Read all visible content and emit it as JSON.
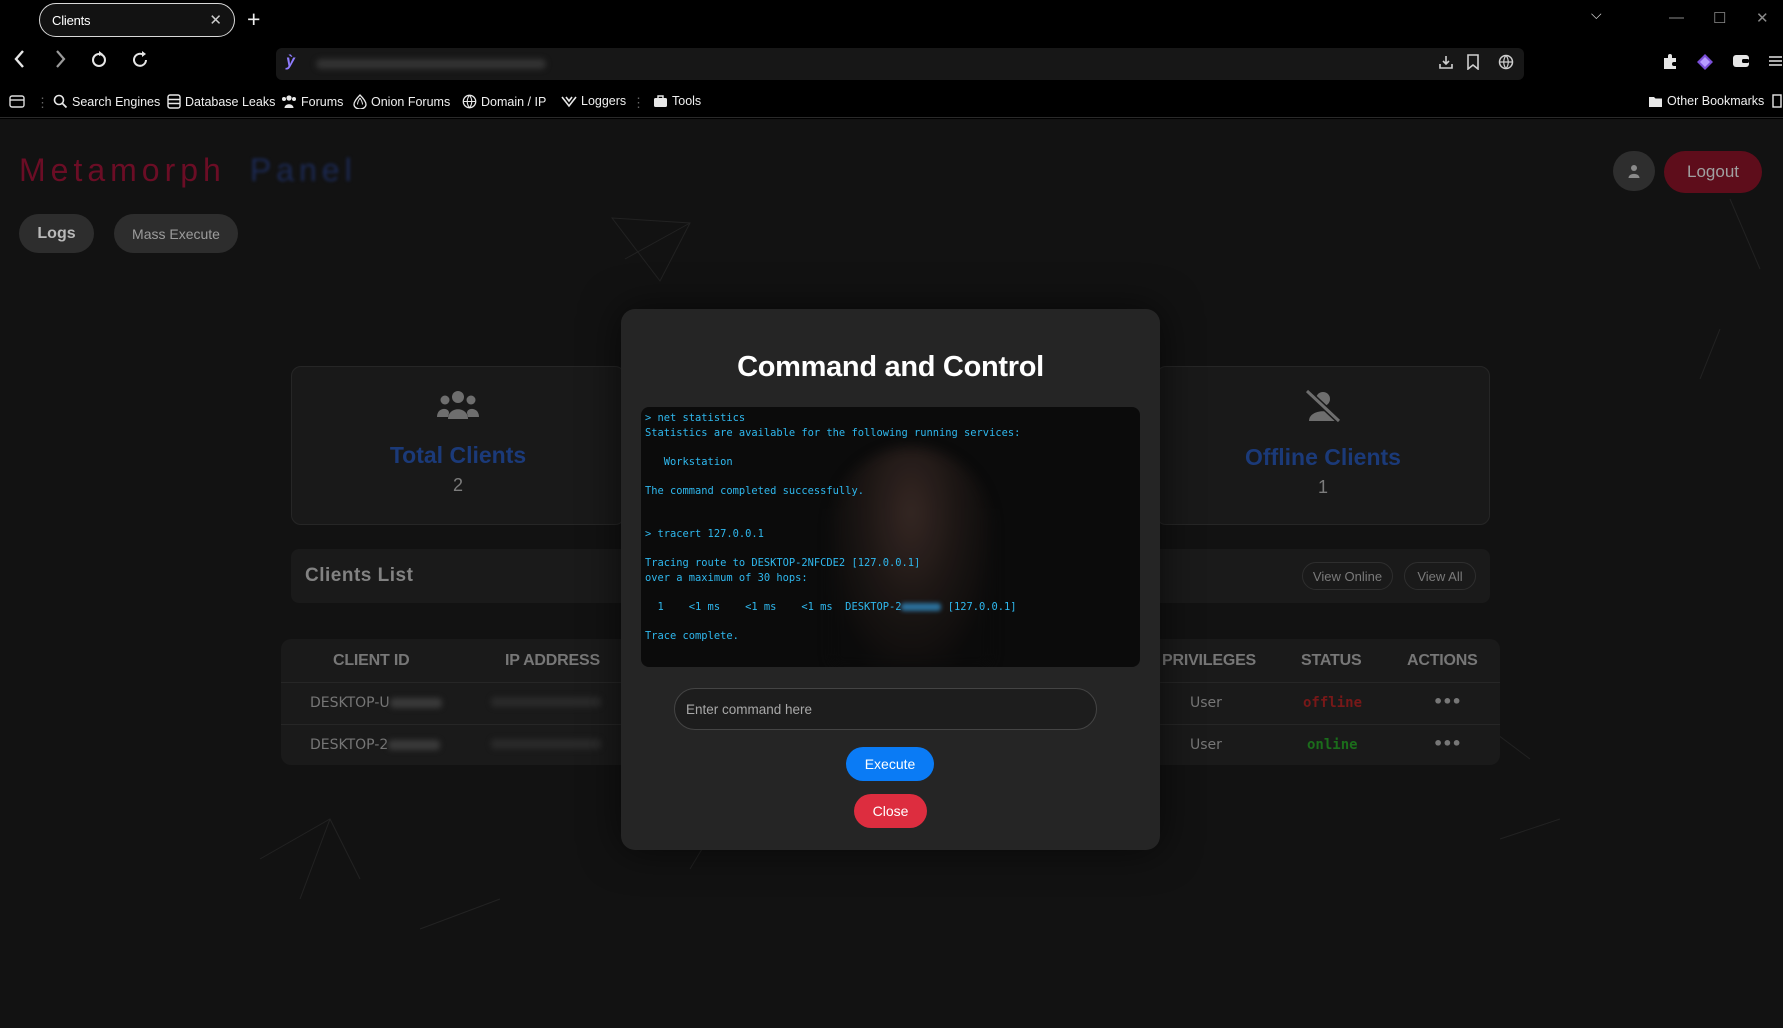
{
  "browser": {
    "tab_title": "Clients",
    "tab_close": "✕",
    "new_tab": "+",
    "tab_menu": "⌵",
    "window_controls": {
      "minimize": "—",
      "maximize": "☐",
      "close": "✕"
    },
    "url_logo": "ỳ",
    "bookmarks": [
      {
        "label": "Search Engines",
        "icon": "search-icon"
      },
      {
        "label": "Database Leaks",
        "icon": "database-icon"
      },
      {
        "label": "Forums",
        "icon": "people-icon"
      },
      {
        "label": "Onion Forums",
        "icon": "onion-icon"
      },
      {
        "label": "Domain / IP",
        "icon": "globe-icon"
      },
      {
        "label": "Loggers",
        "icon": "logger-icon"
      },
      {
        "label": "Tools",
        "icon": "toolbox-icon"
      }
    ],
    "other_bookmarks": "Other Bookmarks"
  },
  "panel": {
    "brand_part1": "Metamorph",
    "brand_part2": "Panel",
    "logs_button": "Logs",
    "mass_execute_button": "Mass Execute",
    "logout_button": "Logout",
    "brand_colors": {
      "part1": "#6b0d25",
      "part2": "#1c2a55"
    }
  },
  "stats": {
    "total": {
      "label": "Total Clients",
      "value": "2",
      "icon": "users-icon"
    },
    "offline": {
      "label": "Offline Clients",
      "value": "1",
      "icon": "user-slash-icon"
    }
  },
  "clients_list": {
    "title": "Clients List",
    "view_online": "View Online",
    "view_all": "View All"
  },
  "table": {
    "headers": [
      "CLIENT ID",
      "IP ADDRESS",
      "PRIVILEGES",
      "STATUS",
      "ACTIONS"
    ],
    "rows": [
      {
        "client_id_prefix": "DESKTOP-U",
        "privileges": "User",
        "status": "offline",
        "actions": "•••"
      },
      {
        "client_id_prefix": "DESKTOP-2",
        "privileges": "User",
        "status": "online",
        "actions": "•••"
      }
    ]
  },
  "modal": {
    "title": "Command and Control",
    "terminal_lines": [
      "> net statistics",
      "Statistics are available for the following running services:",
      "",
      "   Workstation",
      "",
      "The command completed successfully.",
      "",
      "",
      "> tracert 127.0.0.1",
      "",
      "Tracing route to DESKTOP-2NFCDE2 [127.0.0.1]",
      "over a maximum of 30 hops:",
      "",
      "  1    <1 ms    <1 ms    <1 ms  DESKTOP-2"
    ],
    "terminal_last_hop_suffix": " [127.0.0.1]",
    "terminal_trailer": [
      "",
      "Trace complete."
    ],
    "command_placeholder": "Enter command here",
    "execute_button": "Execute",
    "close_button": "Close",
    "colors": {
      "terminal_text": "#2fb8ee",
      "execute": "#0a7bf5",
      "close": "#dd2d3f"
    }
  }
}
